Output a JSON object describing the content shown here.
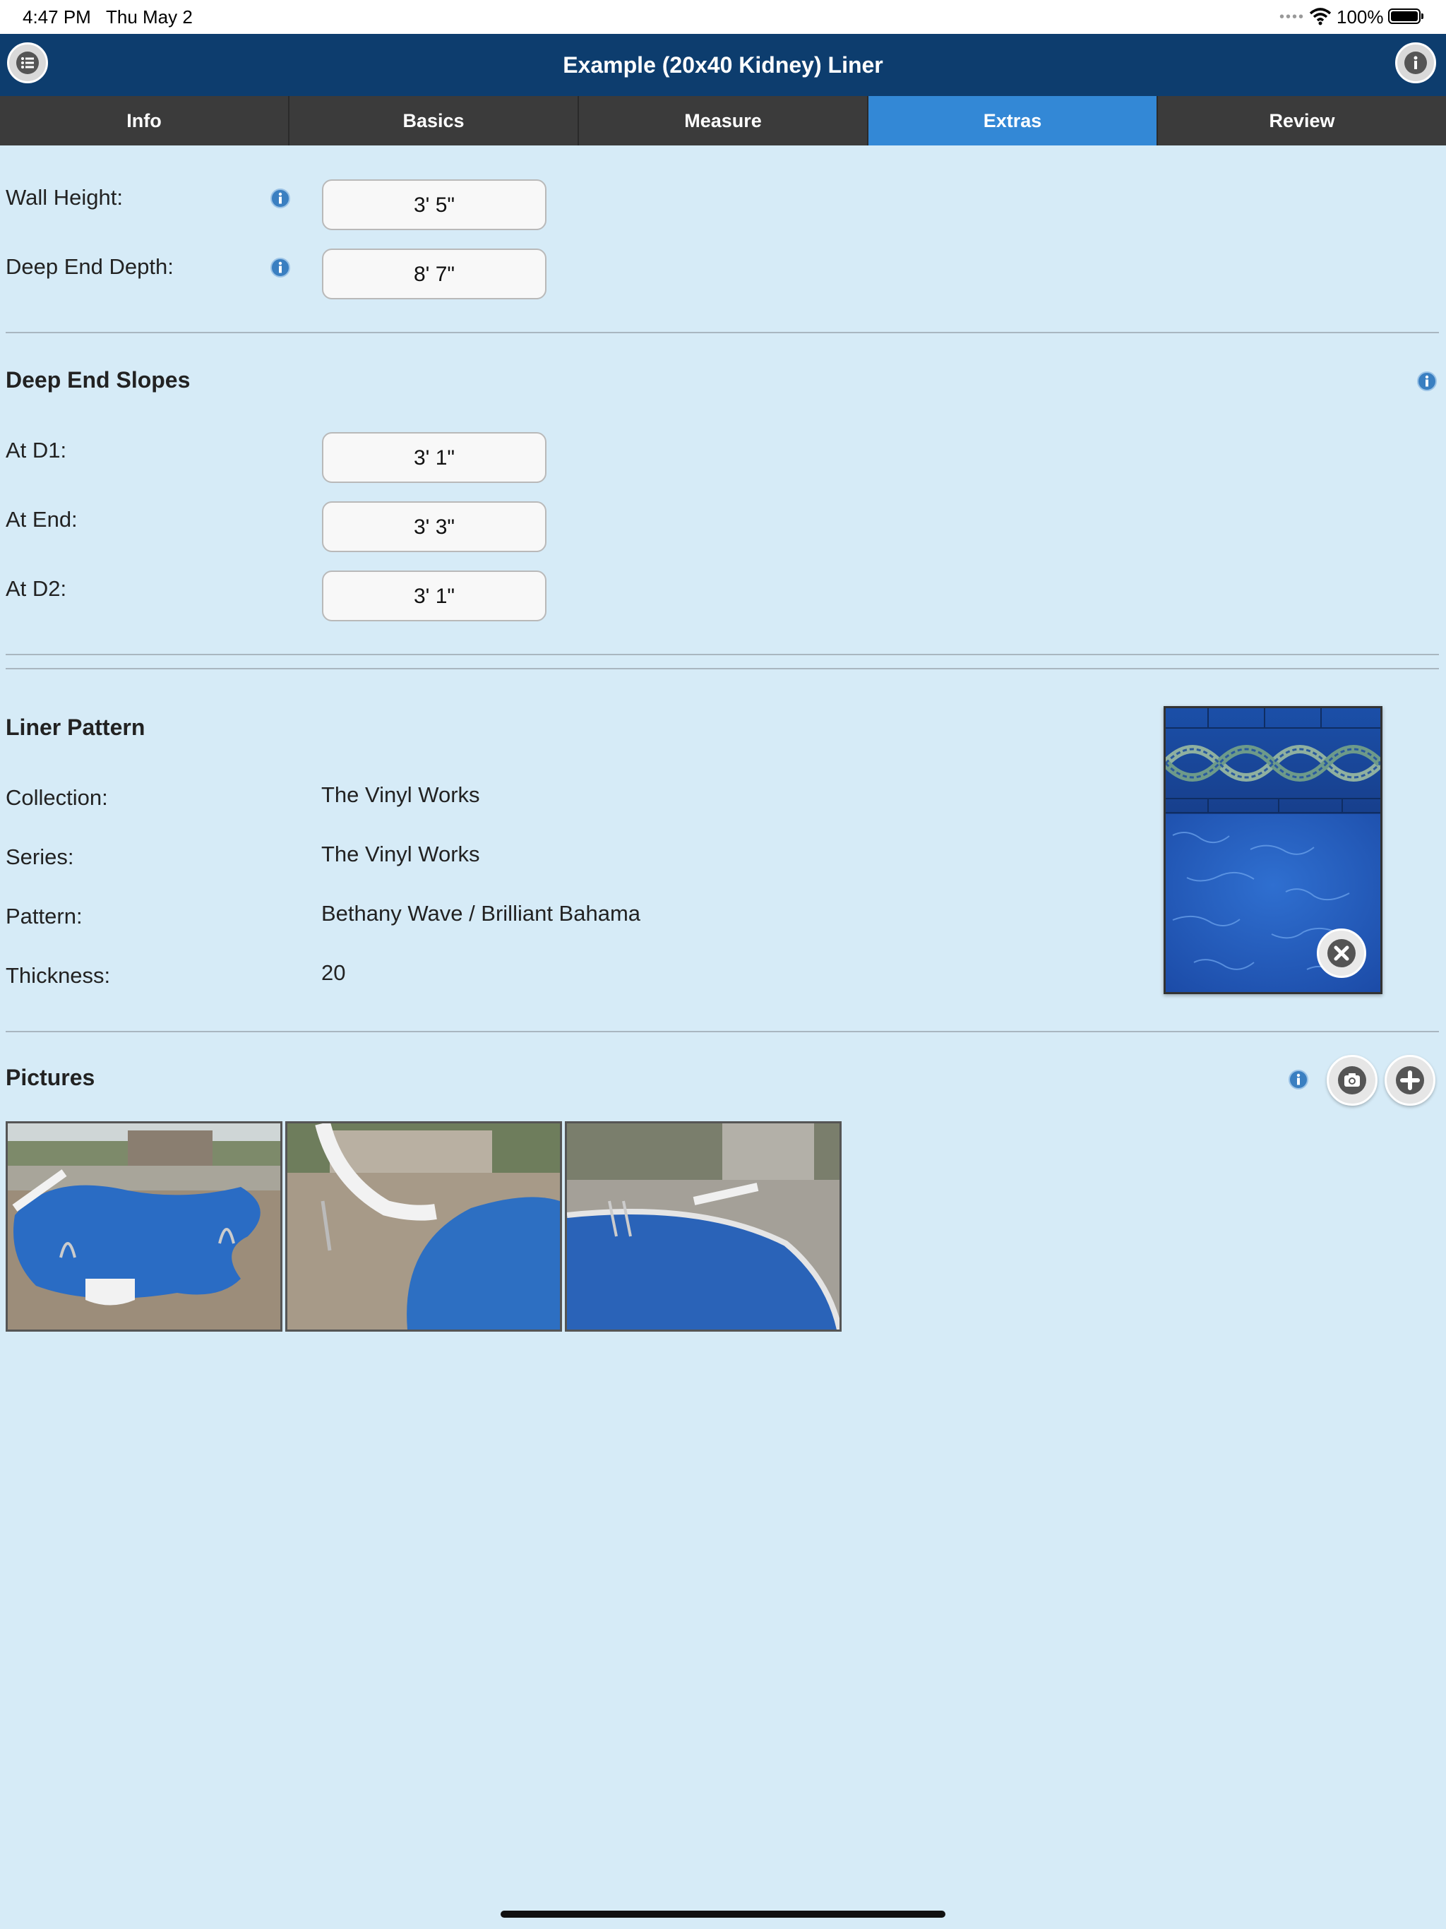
{
  "status": {
    "time": "4:47 PM",
    "date": "Thu May 2",
    "battery": "100%"
  },
  "header": {
    "title": "Example (20x40 Kidney) Liner",
    "menu_icon": "list-icon",
    "info_icon": "info-icon"
  },
  "tabs": [
    {
      "label": "Info",
      "active": false
    },
    {
      "label": "Basics",
      "active": false
    },
    {
      "label": "Measure",
      "active": false
    },
    {
      "label": "Extras",
      "active": true
    },
    {
      "label": "Review",
      "active": false
    }
  ],
  "depths": {
    "wall_height_label": "Wall Height:",
    "wall_height_value": "3' 5\"",
    "deep_end_label": "Deep End Depth:",
    "deep_end_value": "8' 7\""
  },
  "slopes": {
    "title": "Deep End Slopes",
    "d1_label": "At D1:",
    "d1_value": "3' 1\"",
    "end_label": "At End:",
    "end_value": "3' 3\"",
    "d2_label": "At D2:",
    "d2_value": "3' 1\""
  },
  "liner": {
    "title": "Liner Pattern",
    "collection_label": "Collection:",
    "collection_value": "The Vinyl Works",
    "series_label": "Series:",
    "series_value": "The Vinyl Works",
    "pattern_label": "Pattern:",
    "pattern_value": "Bethany Wave / Brilliant Bahama",
    "thickness_label": "Thickness:",
    "thickness_value": "20"
  },
  "pictures": {
    "title": "Pictures",
    "count": 3
  },
  "colors": {
    "navbar": "#0d3d6e",
    "tab_bg": "#3b3b3b",
    "tab_active": "#3388d6",
    "page_bg": "#d6ebf7"
  }
}
